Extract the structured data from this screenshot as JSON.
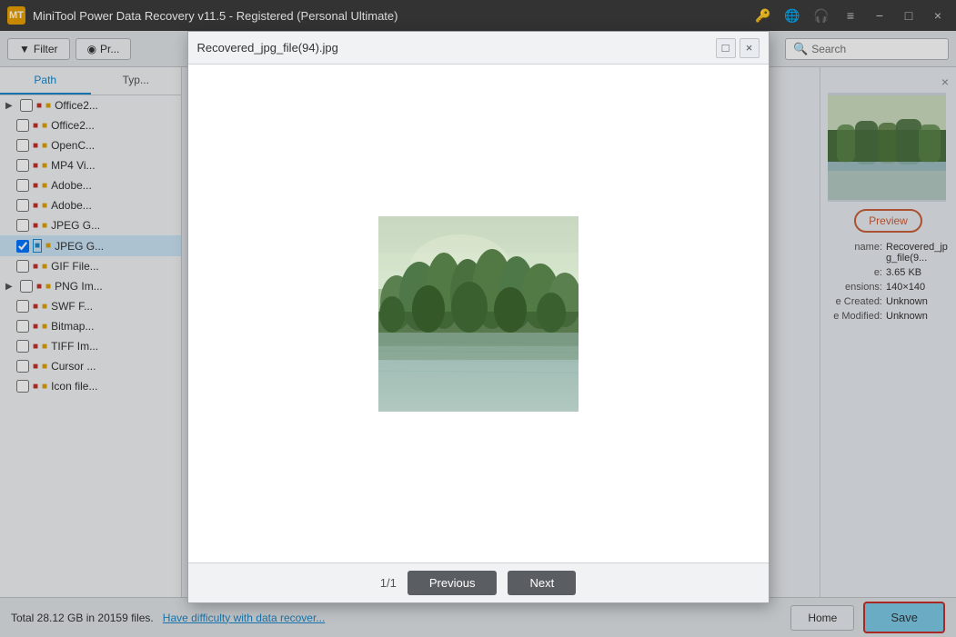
{
  "app": {
    "title": "MiniTool Power Data Recovery v11.5 - Registered (Personal Ultimate)",
    "icon_label": "MT"
  },
  "title_bar": {
    "controls": {
      "minimize": "−",
      "maximize": "□",
      "close": "×"
    }
  },
  "toolbar": {
    "filter_label": "Filter",
    "preview_label": "Pr...",
    "search_placeholder": "Search"
  },
  "tabs": {
    "path_label": "Path",
    "type_label": "Typ..."
  },
  "file_list": {
    "items": [
      {
        "name": "Office2...",
        "has_arrow": true,
        "level": 0
      },
      {
        "name": "Office2...",
        "has_arrow": false,
        "level": 1
      },
      {
        "name": "OpenC...",
        "has_arrow": false,
        "level": 1
      },
      {
        "name": "MP4 Vi...",
        "has_arrow": false,
        "level": 1
      },
      {
        "name": "Adobe...",
        "has_arrow": false,
        "level": 1
      },
      {
        "name": "Adobe...",
        "has_arrow": false,
        "level": 1
      },
      {
        "name": "JPEG G...",
        "has_arrow": false,
        "level": 1
      },
      {
        "name": "JPEG G...",
        "has_arrow": false,
        "level": 1,
        "selected": true
      },
      {
        "name": "GIF File...",
        "has_arrow": false,
        "level": 1
      },
      {
        "name": "PNG Im...",
        "has_arrow": true,
        "level": 0
      },
      {
        "name": "SWF F...",
        "has_arrow": false,
        "level": 1
      },
      {
        "name": "Bitmap...",
        "has_arrow": false,
        "level": 1
      },
      {
        "name": "TIFF Im...",
        "has_arrow": false,
        "level": 1
      },
      {
        "name": "Cursor ...",
        "has_arrow": false,
        "level": 1
      },
      {
        "name": "Icon file...",
        "has_arrow": false,
        "level": 1
      }
    ]
  },
  "preview_panel": {
    "preview_button_label": "Preview",
    "close_symbol": "×"
  },
  "file_info": {
    "name_label": "name:",
    "name_value": "Recovered_jpg_file(9...",
    "size_label": "e:",
    "size_value": "3.65 KB",
    "dimensions_label": "ensions:",
    "dimensions_value": "140×140",
    "created_label": "e Created:",
    "created_value": "Unknown",
    "modified_label": "e Modified:",
    "modified_value": "Unknown"
  },
  "status_bar": {
    "total_text": "Total 28.12 GB in 20159 files.",
    "help_link": "Have difficulty with data recover...",
    "home_label": "Home",
    "save_label": "Save"
  },
  "modal": {
    "title": "Recovered_jpg_file(94).jpg",
    "page_indicator": "1/1",
    "previous_label": "Previous",
    "next_label": "Next",
    "close_symbol": "×",
    "maximize_symbol": "□"
  }
}
